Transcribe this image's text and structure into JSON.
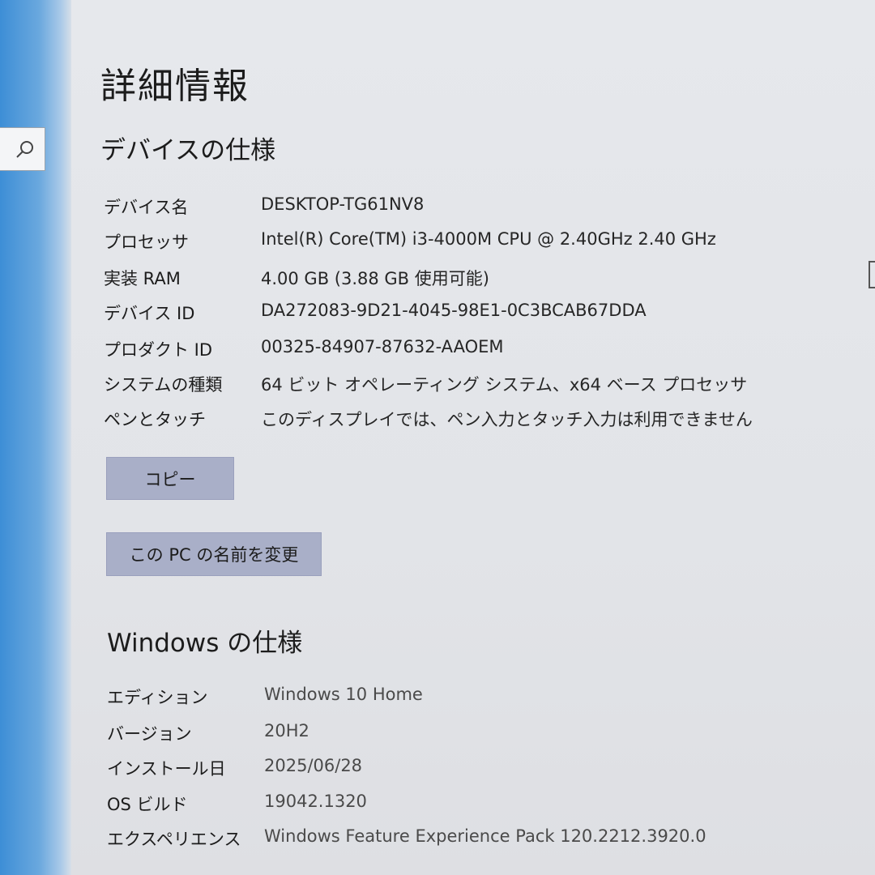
{
  "page": {
    "title": "詳細情報"
  },
  "search": {
    "icon": "search-icon"
  },
  "device_specs": {
    "heading": "デバイスの仕様",
    "rows": [
      {
        "label": "デバイス名",
        "value": "DESKTOP-TG61NV8"
      },
      {
        "label": "プロセッサ",
        "value": "Intel(R) Core(TM) i3-4000M CPU @ 2.40GHz   2.40 GHz"
      },
      {
        "label": "実装 RAM",
        "value": "4.00 GB (3.88 GB 使用可能)"
      },
      {
        "label": "デバイス ID",
        "value": "DA272083-9D21-4045-98E1-0C3BCAB67DDA"
      },
      {
        "label": "プロダクト ID",
        "value": "00325-84907-87632-AAOEM"
      },
      {
        "label": "システムの種類",
        "value": "64 ビット オペレーティング システム、x64 ベース プロセッサ"
      },
      {
        "label": "ペンとタッチ",
        "value": "このディスプレイでは、ペン入力とタッチ入力は利用できません"
      }
    ],
    "copy_button": "コピー",
    "rename_button": "この PC の名前を変更"
  },
  "windows_specs": {
    "heading": "Windows の仕様",
    "rows": [
      {
        "label": "エディション",
        "value": "Windows 10 Home"
      },
      {
        "label": "バージョン",
        "value": "20H2"
      },
      {
        "label": "インストール日",
        "value": "2025/06/28"
      },
      {
        "label": "OS ビルド",
        "value": "19042.1320"
      },
      {
        "label": "エクスペリエンス",
        "value": "Windows Feature Experience Pack 120.2212.3920.0"
      }
    ]
  },
  "colors": {
    "accent": "#3d8ed6",
    "button_bg": "#a9afc8",
    "background": "#e4e6ea"
  }
}
